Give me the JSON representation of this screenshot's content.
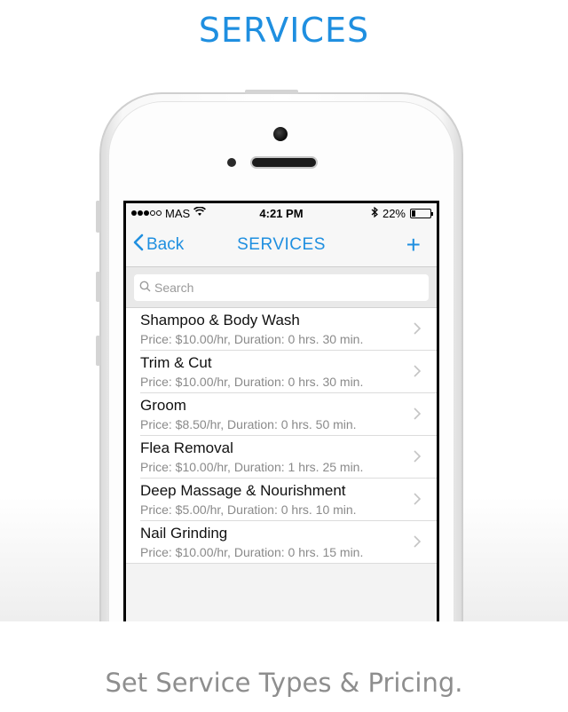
{
  "header": {
    "title": "SERVICES"
  },
  "tagline": "Set Service Types & Pricing.",
  "colors": {
    "accent": "#1f8fe0",
    "tagline": "#8e8e8e"
  },
  "status_bar": {
    "carrier": "MAS",
    "time": "4:21 PM",
    "battery": "22%",
    "battery_level": 0.22,
    "signal_filled": 3,
    "signal_total": 5
  },
  "nav": {
    "back_label": "Back",
    "title": "SERVICES",
    "add_label": "+"
  },
  "search": {
    "placeholder": "Search"
  },
  "services": [
    {
      "name": "Shampoo & Body Wash",
      "detail": "Price: $10.00/hr, Duration: 0 hrs. 30 min."
    },
    {
      "name": "Trim & Cut",
      "detail": "Price: $10.00/hr, Duration: 0 hrs. 30 min."
    },
    {
      "name": "Groom",
      "detail": "Price: $8.50/hr, Duration: 0 hrs. 50 min."
    },
    {
      "name": "Flea Removal",
      "detail": "Price: $10.00/hr, Duration: 1 hrs. 25 min."
    },
    {
      "name": "Deep Massage & Nourishment",
      "detail": "Price: $5.00/hr, Duration: 0 hrs. 10 min."
    },
    {
      "name": "Nail Grinding",
      "detail": "Price: $10.00/hr, Duration: 0 hrs. 15 min."
    }
  ]
}
